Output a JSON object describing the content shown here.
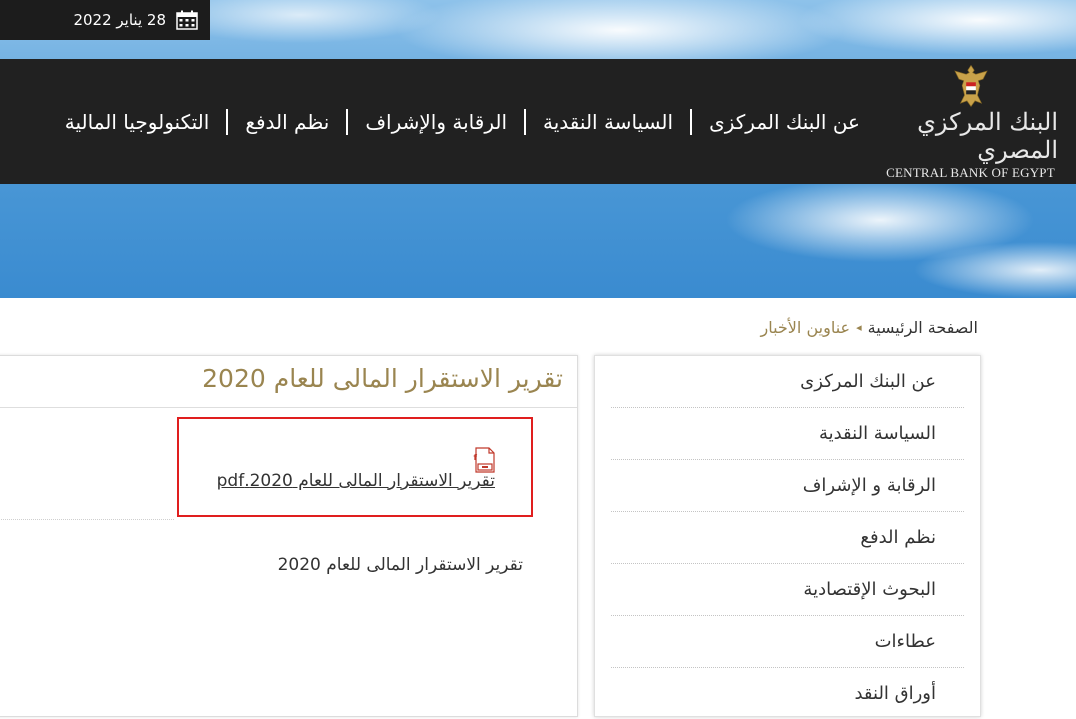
{
  "header": {
    "date": "28 يناير 2022",
    "logo": {
      "arabic": "البنك المركزي المصري",
      "english": "CENTRAL BANK OF EGYPT"
    },
    "nav": [
      {
        "label": "عن البنك المركزى"
      },
      {
        "label": "السياسة النقدية"
      },
      {
        "label": "الرقابة والإشراف"
      },
      {
        "label": "نظم الدفع"
      },
      {
        "label": "التكنولوجيا المالية"
      }
    ]
  },
  "breadcrumb": {
    "home": "الصفحة الرئيسية",
    "current": "عناوين الأخبار"
  },
  "sidebar": {
    "items": [
      {
        "label": "عن البنك المركزى"
      },
      {
        "label": "السياسة النقدية"
      },
      {
        "label": "الرقابة و الإشراف"
      },
      {
        "label": "نظم الدفع"
      },
      {
        "label": "البحوث الإقتصادية"
      },
      {
        "label": "عطاءات"
      },
      {
        "label": "أوراق النقد"
      }
    ]
  },
  "article": {
    "title": "تقرير الاستقرار المالى للعام 2020",
    "attachment": {
      "icon_label": "pdf",
      "link_text": "تقرير الاستقرار المالى للعام 2020.pdf"
    },
    "body": "تقرير الاستقرار المالى للعام 2020"
  },
  "colors": {
    "accent_gold": "#9a8550",
    "nav_bg": "#212121",
    "highlight_border": "#e01e1e"
  }
}
